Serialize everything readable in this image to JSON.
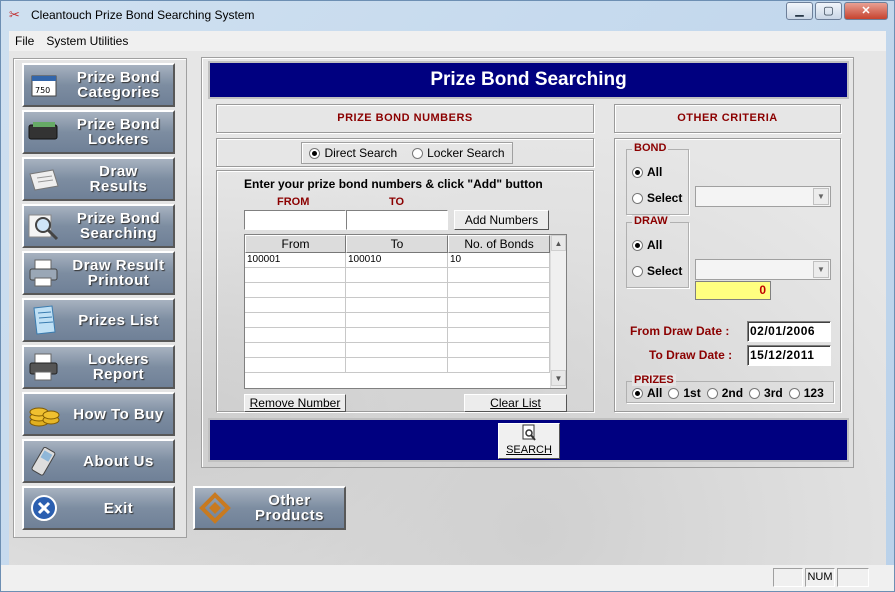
{
  "window": {
    "title": "Cleantouch Prize Bond Searching System",
    "icon": "app-icon",
    "buttons": [
      "minimize",
      "maximize",
      "close"
    ]
  },
  "menu": [
    "File",
    "System Utilities"
  ],
  "sidebar": [
    {
      "label_line1": "Prize Bond",
      "label_line2": "Categories",
      "icon": "bond-card-icon"
    },
    {
      "label_line1": "Prize Bond",
      "label_line2": "Lockers",
      "icon": "locker-icon"
    },
    {
      "label_line1": "Draw",
      "label_line2": "Results",
      "icon": "newspaper-icon"
    },
    {
      "label_line1": "Prize Bond",
      "label_line2": "Searching",
      "icon": "magnifier-icon"
    },
    {
      "label_line1": "Draw Result",
      "label_line2": "Printout",
      "icon": "printer-icon"
    },
    {
      "label_line1": "Prizes List",
      "label_line2": "",
      "icon": "notepad-icon"
    },
    {
      "label_line1": "Lockers",
      "label_line2": "Report",
      "icon": "printer-report-icon"
    },
    {
      "label_line1": "How To Buy",
      "label_line2": "",
      "icon": "coins-icon"
    },
    {
      "label_line1": "About Us",
      "label_line2": "",
      "icon": "phone-icon"
    },
    {
      "label_line1": "Exit",
      "label_line2": "",
      "icon": "close-icon"
    }
  ],
  "other_products": {
    "line1": "Other",
    "line2": "Products",
    "icon": "logo-icon"
  },
  "header": {
    "title": "Prize Bond Searching"
  },
  "numbers_panel": {
    "title": "PRIZE BOND NUMBERS",
    "search_modes": [
      {
        "label": "Direct Search",
        "selected": true
      },
      {
        "label": "Locker Search",
        "selected": false
      }
    ],
    "instruction": "Enter your prize bond numbers & click \"Add\" button",
    "from_label": "FROM",
    "to_label": "TO",
    "from_value": "",
    "to_value": "",
    "add_button": "Add Numbers",
    "columns": [
      "From",
      "To",
      "No. of Bonds"
    ],
    "rows": [
      [
        "100001",
        "100010",
        "10"
      ]
    ],
    "remove_button": "Remove Number",
    "clear_button": "Clear List"
  },
  "criteria_panel": {
    "title": "OTHER CRITERIA",
    "bond": {
      "label": "BOND",
      "options": [
        {
          "label": "All",
          "selected": true
        },
        {
          "label": "Select",
          "selected": false
        }
      ],
      "select_value": ""
    },
    "draw": {
      "label": "DRAW",
      "options": [
        {
          "label": "All",
          "selected": true
        },
        {
          "label": "Select",
          "selected": false
        }
      ],
      "select_value": "",
      "count": "0"
    },
    "from_date_label": "From Draw Date :",
    "from_date": "02/01/2006",
    "to_date_label": "To Draw Date :",
    "to_date": "15/12/2011",
    "prizes": {
      "label": "PRIZES",
      "options": [
        {
          "label": "All",
          "selected": true
        },
        {
          "label": "1st",
          "selected": false
        },
        {
          "label": "2nd",
          "selected": false
        },
        {
          "label": "3rd",
          "selected": false
        },
        {
          "label": "123",
          "selected": false
        }
      ]
    }
  },
  "search_button": {
    "label": "SEARCH",
    "icon": "search-doc-icon"
  },
  "status": {
    "num": "NUM"
  },
  "colors": {
    "header_band": "#000080",
    "nav_button": "#7d8da1",
    "label_red": "#8b0000",
    "count_box": "#ffff80"
  }
}
